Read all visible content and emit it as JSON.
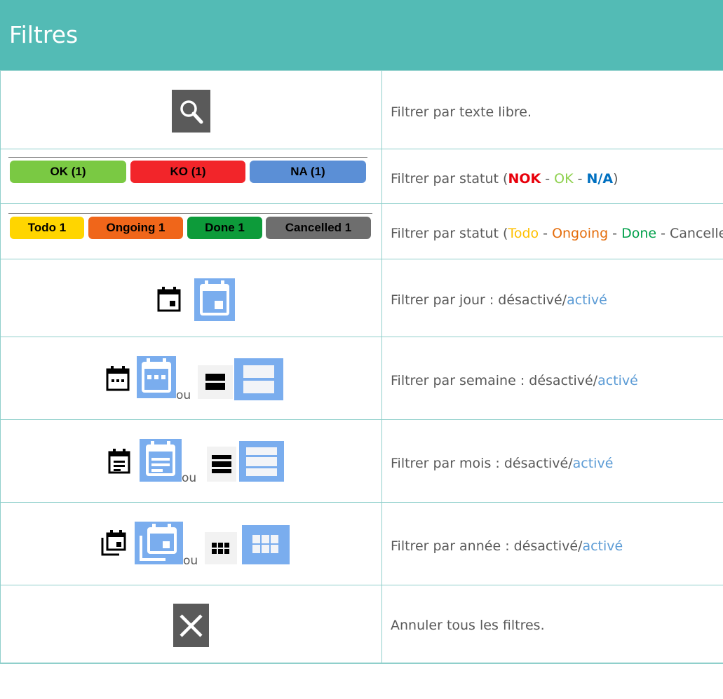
{
  "header": {
    "title": "Filtres"
  },
  "rows": [
    {
      "description": "Filtrer par texte libre."
    },
    {
      "description_prefix": "Filtrer par statut (",
      "status_nok": "NOK",
      "sep1": " - ",
      "status_ok": "OK",
      "sep2": " - ",
      "status_na": "N/A",
      "suffix": ")",
      "buttons": [
        {
          "label": "OK (1)",
          "color": "#7ac943"
        },
        {
          "label": "KO (1)",
          "color": "#f2252a"
        },
        {
          "label": "NA (1)",
          "color": "#5b8fd6"
        }
      ]
    },
    {
      "description_prefix": "Filtrer par statut (",
      "status_todo": "Todo",
      "sep1": " - ",
      "status_ongoing": "Ongoing",
      "sep2": " - ",
      "status_done": "Done",
      "sep3": " - ",
      "status_cancelled": "Cancelled",
      "buttons": [
        {
          "label": "Todo 1",
          "color": "#ffd500"
        },
        {
          "label": "Ongoing 1",
          "color": "#f0661a"
        },
        {
          "label": "Done 1",
          "color": "#0d9b3a"
        },
        {
          "label": "Cancelled 1",
          "color": "#6e6e6e"
        }
      ]
    },
    {
      "description_prefix": "Filtrer par jour : désactivé/",
      "active": "activé"
    },
    {
      "description_prefix": "Filtrer par semaine : désactivé/",
      "active": "activé",
      "or": "ou"
    },
    {
      "description_prefix": "Filtrer par mois : désactivé/",
      "active": "activé",
      "or": "ou"
    },
    {
      "description_prefix": "Filtrer par année : désactivé/",
      "active": "activé",
      "or": "ou"
    },
    {
      "description": "Annuler tous les filtres."
    }
  ],
  "icons": {
    "search": "search-icon",
    "day": "calendar-day-icon",
    "week": "calendar-week-icon",
    "week_list": "rows-two-icon",
    "month": "calendar-month-icon",
    "month_list": "rows-three-icon",
    "year": "calendar-stack-icon",
    "year_grid": "grid-icon",
    "clear": "close-icon"
  }
}
